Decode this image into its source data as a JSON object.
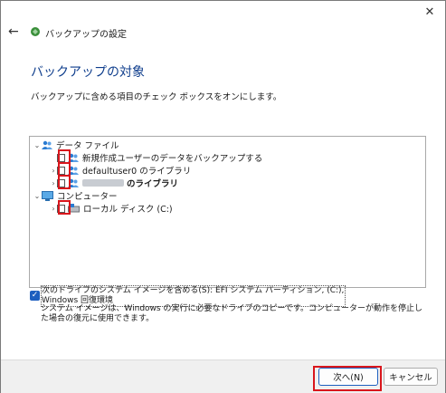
{
  "window": {
    "close_glyph": "✕"
  },
  "header": {
    "title": "バックアップの設定"
  },
  "page": {
    "title": "バックアップの対象",
    "description": "バックアップに含める項目のチェック ボックスをオンにします。"
  },
  "tree": {
    "data_files": "データ ファイル",
    "new_users": "新規作成ユーザーのデータをバックアップする",
    "default_user_lib": "defaultuser0 のライブラリ",
    "user_lib_suffix": "のライブラリ",
    "computer": "コンピューター",
    "local_disk": "ローカル ディスク (C:)"
  },
  "system_image": {
    "checked": true,
    "label": "次のドライブのシステム イメージを含める(S): EFI システム パーティション, (C:), Windows 回復環境",
    "description": "システム イメージは、Windows の実行に必要なドライブのコピーです。コンピューターが動作を停止した場合の復元に使用できます。"
  },
  "buttons": {
    "next": "次へ(N)",
    "cancel": "キャンセル"
  }
}
